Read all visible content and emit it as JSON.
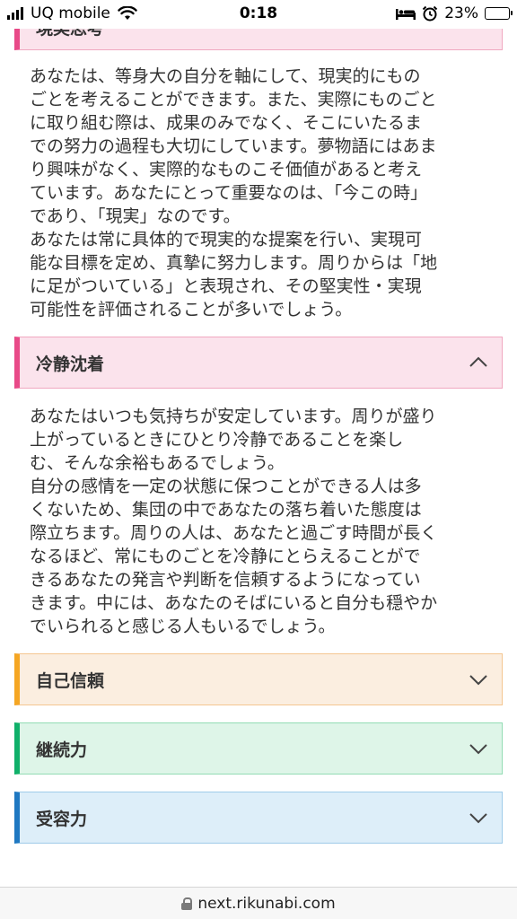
{
  "status_bar": {
    "carrier": "UQ mobile",
    "time": "0:18",
    "battery": "23%",
    "battery_level": 0.23,
    "icons": [
      "signal-icon",
      "wifi-icon",
      "bed-icon",
      "alarm-icon",
      "battery-icon"
    ]
  },
  "sections": [
    {
      "title": "現実思考",
      "color": "#e84a88",
      "expanded": true,
      "body": "あなたは、等身大の自分を軸にして、現実的にもの\nごとを考えることができます。また、実際にものごと\nに取り組む際は、成果のみでなく、そこにいたるま\nでの努力の過程も大切にしています。夢物語にはあま\nり興味がなく、実際的なものこそ価値があると考え\nています。あなたにとって重要なのは、「今この時」\nであり、「現実」なのです。\nあなたは常に具体的で現実的な提案を行い、実現可\n能な目標を定め、真摯に努力します。周りからは「地\nに足がついている」と表現され、その堅実性・実現\n可能性を評価されることが多いでしょう。"
    },
    {
      "title": "冷静沈着",
      "color": "#e84a88",
      "expanded": true,
      "icon": "chevron-up-icon",
      "body": "あなたはいつも気持ちが安定しています。周りが盛り\n上がっているときにひとり冷静であることを楽し\nむ、そんな余裕もあるでしょう。\n自分の感情を一定の状態に保つことができる人は多\nくないため、集団の中であなたの落ち着いた態度は\n際立ちます。周りの人は、あなたと過ごす時間が長く\nなるほど、常にものごとを冷静にとらえることがで\nきるあなたの発言や判断を信頼するようになってい\nきます。中には、あなたのそばにいると自分も穏やか\nでいられると感じる人もいるでしょう。"
    },
    {
      "title": "自己信頼",
      "color": "#f5a623",
      "expanded": false,
      "icon": "chevron-down-icon"
    },
    {
      "title": "継続力",
      "color": "#10b06a",
      "expanded": false,
      "icon": "chevron-down-icon"
    },
    {
      "title": "受容力",
      "color": "#1f78c1",
      "expanded": false,
      "icon": "chevron-down-icon"
    }
  ],
  "url_bar": {
    "url": "next.rikunabi.com",
    "icon": "lock-icon"
  }
}
